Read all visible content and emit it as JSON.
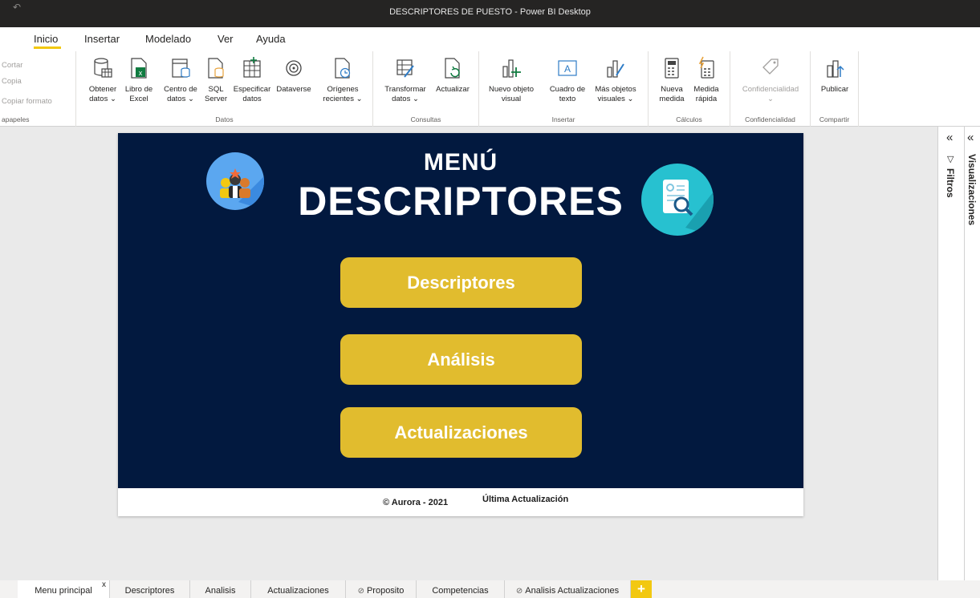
{
  "window": {
    "title": "DESCRIPTORES DE PUESTO - Power BI Desktop"
  },
  "ribbon_tabs": [
    "Inicio",
    "Insertar",
    "Modelado",
    "Ver",
    "Ayuda"
  ],
  "clipboard": {
    "cut": "Cortar",
    "copy": "Copia",
    "format_painter": "Copiar formato",
    "group": "apapeles"
  },
  "data_group": {
    "label": "Datos",
    "get_data": [
      "Obtener",
      "datos ⌄"
    ],
    "excel": [
      "Libro de",
      "Excel"
    ],
    "data_hub": [
      "Centro de",
      "datos ⌄"
    ],
    "sql": [
      "SQL",
      "Server"
    ],
    "enter_data": [
      "Especificar",
      "datos"
    ],
    "dataverse": [
      "Dataverse",
      ""
    ],
    "recent": [
      "Orígenes",
      "recientes ⌄"
    ]
  },
  "queries_group": {
    "label": "Consultas",
    "transform": [
      "Transformar",
      "datos ⌄"
    ],
    "refresh": [
      "Actualizar",
      ""
    ]
  },
  "insert_group": {
    "label": "Insertar",
    "new_visual": [
      "Nuevo objeto",
      "visual"
    ],
    "text_box": [
      "Cuadro de",
      "texto"
    ],
    "more_visuals": [
      "Más objetos",
      "visuales ⌄"
    ]
  },
  "calc_group": {
    "label": "Cálculos",
    "new_measure": [
      "Nueva",
      "medida"
    ],
    "quick_measure": [
      "Medida",
      "rápida"
    ]
  },
  "sensitivity_group": {
    "label": "Confidencialidad",
    "sensitivity": [
      "Confidencialidad",
      "⌄"
    ]
  },
  "share_group": {
    "label": "Compartir",
    "publish": [
      "Publicar",
      ""
    ]
  },
  "report": {
    "menu_title": "MENÚ",
    "menu_subtitle": "DESCRIPTORES",
    "buttons": [
      "Descriptores",
      "Análisis",
      "Actualizaciones"
    ],
    "footer_copyright": "© Aurora - 2021",
    "footer_update": "Última Actualización",
    "colors": {
      "background": "#02193f",
      "button": "#e1bc2e"
    }
  },
  "panes": {
    "filters": "Filtros",
    "visualizations": "Visualizaciones"
  },
  "page_tabs": [
    {
      "label": "Menu principal",
      "active": true,
      "hidden": false
    },
    {
      "label": "Descriptores",
      "active": false,
      "hidden": false
    },
    {
      "label": "Analisis",
      "active": false,
      "hidden": false
    },
    {
      "label": "Actualizaciones",
      "active": false,
      "hidden": false
    },
    {
      "label": "Proposito",
      "active": false,
      "hidden": true
    },
    {
      "label": "Competencias",
      "active": false,
      "hidden": false
    },
    {
      "label": "Analisis Actualizaciones",
      "active": false,
      "hidden": true
    }
  ],
  "add_page": "+"
}
